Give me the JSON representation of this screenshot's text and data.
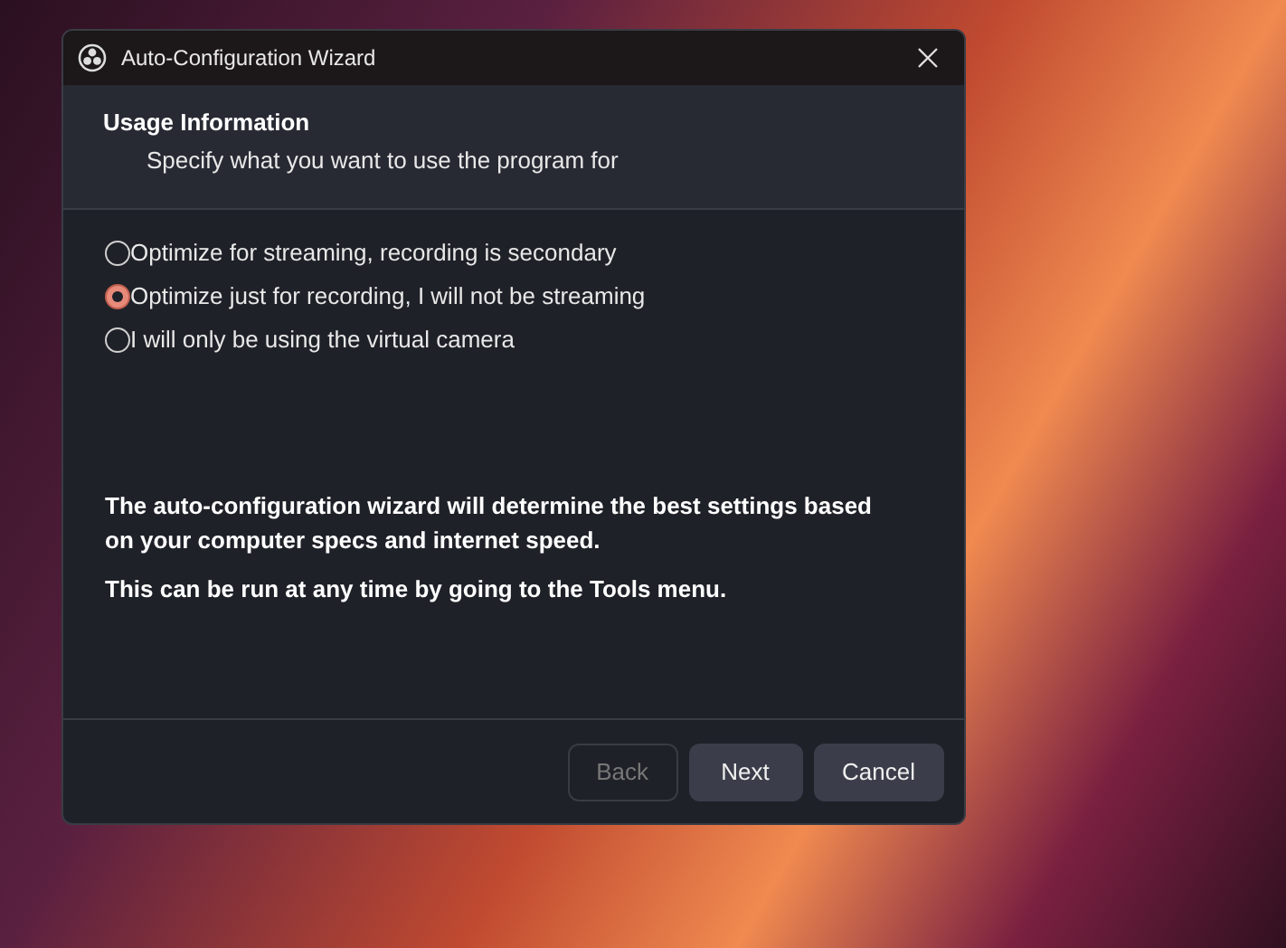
{
  "window": {
    "title": "Auto-Configuration Wizard"
  },
  "header": {
    "title": "Usage Information",
    "subtitle": "Specify what you want to use the program for"
  },
  "options": [
    {
      "label": "Optimize for streaming, recording is secondary",
      "selected": false
    },
    {
      "label": "Optimize just for recording, I will not be streaming",
      "selected": true
    },
    {
      "label": "I will only be using the virtual camera",
      "selected": false
    }
  ],
  "info": [
    "The auto-configuration wizard will determine the best settings based on your computer specs and internet speed.",
    "This can be run at any time by going to the Tools menu."
  ],
  "buttons": [
    {
      "label": "Back",
      "disabled": true
    },
    {
      "label": "Next",
      "disabled": false
    },
    {
      "label": "Cancel",
      "disabled": false
    }
  ]
}
